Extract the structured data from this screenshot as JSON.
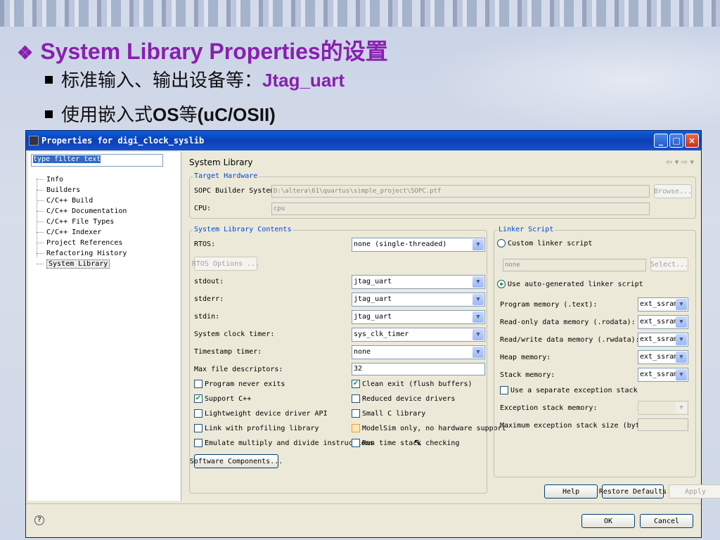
{
  "slide": {
    "title_prefix": "❖",
    "title": "System Library Properties的设置",
    "bullet1_text": "标准输入、输出设备等：",
    "bullet1_highlight": "Jtag_uart",
    "bullet2_text": "使用嵌入式",
    "bullet2_os": "OS",
    "bullet2_text2": "等",
    "bullet2_highlight": "(uC/OSII)",
    "title_color": "#8a1fb0"
  },
  "dialog": {
    "title": "Properties for digi_clock_syslib",
    "minimize": "_",
    "maximize": "□",
    "close": "×",
    "filter_placeholder": "type filter text",
    "tree": [
      "Info",
      "Builders",
      "C/C++ Build",
      "C/C++ Documentation",
      "C/C++ File Types",
      "C/C++ Indexer",
      "Project References",
      "Refactoring History",
      "System Library"
    ],
    "page_title": "System Library",
    "nav_arrows": "⇦ ▾ ⇨ ▾",
    "target_hardware": {
      "label": "Target Hardware",
      "sopc_label": "SOPC Builder System:",
      "sopc_value": "D:\\altera\\61\\quartus\\simple_project\\SOPC.ptf",
      "browse": "Browse...",
      "cpu_label": "CPU:",
      "cpu_value": "cpu"
    },
    "contents": {
      "label": "System Library Contents",
      "rtos_label": "RTOS:",
      "rtos_value": "none (single-threaded)",
      "rtos_options": "RTOS Options ...",
      "stdout_label": "stdout:",
      "stdout_value": "jtag_uart",
      "stderr_label": "stderr:",
      "stderr_value": "jtag_uart",
      "stdin_label": "stdin:",
      "stdin_value": "jtag_uart",
      "sys_clk_label": "System clock timer:",
      "sys_clk_value": "sys_clk_timer",
      "timestamp_label": "Timestamp timer:",
      "timestamp_value": "none",
      "max_fd_label": "Max file descriptors:",
      "max_fd_value": "32",
      "program_never_exits": "Program never exits",
      "clean_exit": "Clean exit (flush buffers)",
      "support_cpp": "Support C++",
      "reduced_drivers": "Reduced device drivers",
      "lightweight_api": "Lightweight device driver API",
      "small_c": "Small C library",
      "link_profiling": "Link with profiling library",
      "modelsim_only": "ModelSim only, no hardware support",
      "emulate_mul": "Emulate multiply and divide instructions",
      "run_time_stack": "Run time stack checking",
      "software_components": "Software Components..."
    },
    "linker": {
      "label": "Linker Script",
      "custom": "Custom linker script",
      "custom_value": "none",
      "select": "Select...",
      "auto": "Use auto-generated linker script",
      "program_mem_label": "Program memory (.text):",
      "program_mem_value": "ext_ssram",
      "ro_mem_label": "Read-only data memory (.rodata):",
      "ro_mem_value": "ext_ssram",
      "rw_mem_label": "Read/write data memory (.rwdata):",
      "rw_mem_value": "ext_ssram",
      "heap_label": "Heap memory:",
      "heap_value": "ext_ssram",
      "stack_label": "Stack memory:",
      "stack_value": "ext_ssram",
      "separate_exc": "Use a separate exception stack",
      "exc_stack_label": "Exception stack memory:",
      "max_exc_label": "Maximum exception stack size (bytes):"
    },
    "buttons": {
      "help": "Help",
      "restore": "Restore Defaults",
      "apply": "Apply",
      "ok": "OK",
      "cancel": "Cancel",
      "question": "?"
    }
  }
}
